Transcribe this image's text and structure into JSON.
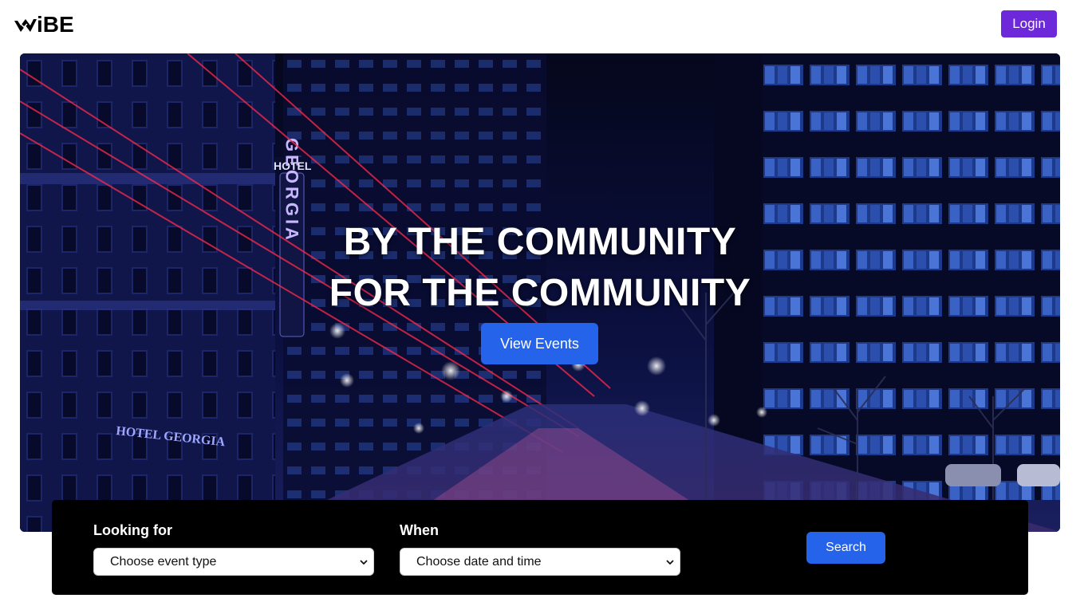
{
  "header": {
    "logo_text": "iBE",
    "login_label": "Login"
  },
  "hero": {
    "title_line1": "BY THE COMMUNITY",
    "title_line2": "FOR THE COMMUNITY",
    "view_events_label": "View Events",
    "sign_hotel": "HOTEL",
    "sign_georgia": "GEORGIA",
    "sign_hotel_georgia": "HOTEL GEORGIA"
  },
  "search": {
    "looking_for_label": "Looking for",
    "looking_for_value": "Choose event type",
    "when_label": "When",
    "when_value": "Choose date and time",
    "search_label": "Search"
  },
  "colors": {
    "login_button": "#6d28d9",
    "primary_button": "#2563eb",
    "panel_background": "#000000"
  }
}
